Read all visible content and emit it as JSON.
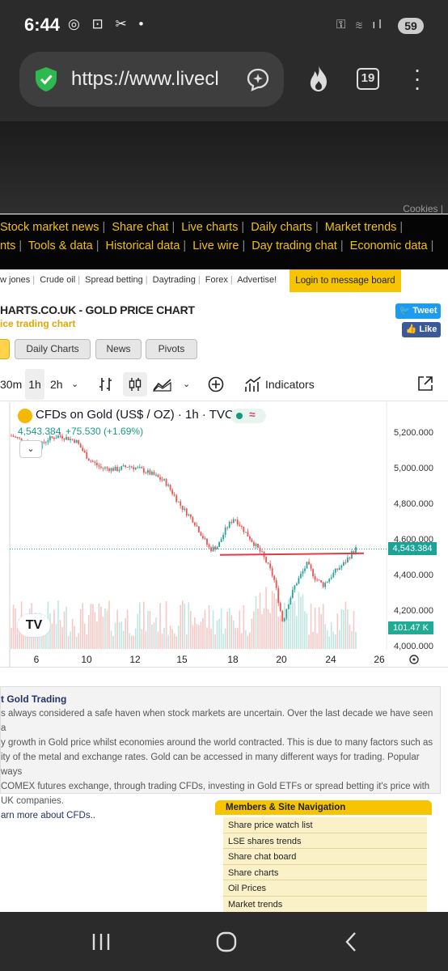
{
  "status": {
    "time": "6:44",
    "icons_left": "◎ ⊡ ✂ •",
    "icons_right": "⚿ ≋ ıl",
    "battery": "59"
  },
  "browser": {
    "url": "https://www.livecl",
    "tab_count": "19"
  },
  "site": {
    "cookies": "Cookies |",
    "nav_row1": [
      "Stock market news",
      "Share chat",
      "Live charts",
      "Daily charts",
      "Market trends"
    ],
    "nav_row2": [
      "nts",
      "Tools & data",
      "Historical data",
      "Live wire",
      "Day trading chat",
      "Economic data"
    ],
    "sub_links": [
      "w jones",
      "Crude oil",
      "Spread betting",
      "Daytrading",
      "Forex",
      "Advertise!"
    ],
    "login": "Login to message board",
    "page_title": "HARTS.CO.UK - GOLD PRICE CHART",
    "page_subtitle": "ice trading chart",
    "tweet": "Tweet",
    "like": "Like",
    "chart_tabs": [
      "Daily Charts",
      "News",
      "Pivots"
    ]
  },
  "toolbar": {
    "interval_30m": "30m",
    "interval_1h": "1h",
    "interval_2h": "2h",
    "indicators": "Indicators"
  },
  "chart_header": {
    "symbol": "CFDs on Gold (US$ / OZ) · 1h · TVC",
    "price": "4,543.384",
    "change": "+75.530 (+1.69%)",
    "last_label": "4,543.384",
    "volume_label": "101.47 K",
    "logo": "TV"
  },
  "chart_data": {
    "type": "candlestick",
    "title": "CFDs on Gold (US$ / OZ) · 1h · TVC",
    "x_ticks": [
      "6",
      "10",
      "12",
      "15",
      "18",
      "20",
      "24",
      "26"
    ],
    "y_ticks": [
      "5,200.000",
      "5,000.000",
      "4,800.000",
      "4,600.000",
      "4,400.000",
      "4,200.000",
      "4,000.000"
    ],
    "ylim": [
      3980,
      5260
    ],
    "price_path": [
      [
        0,
        5180
      ],
      [
        4,
        5140
      ],
      [
        6,
        5100
      ],
      [
        9,
        5160
      ],
      [
        12,
        5180
      ],
      [
        16,
        5150
      ],
      [
        19,
        5050
      ],
      [
        22,
        5000
      ],
      [
        26,
        4990
      ],
      [
        29,
        5010
      ],
      [
        32,
        4990
      ],
      [
        35,
        4960
      ],
      [
        38,
        4920
      ],
      [
        40,
        4850
      ],
      [
        42,
        4780
      ],
      [
        45,
        4700
      ],
      [
        47,
        4620
      ],
      [
        49,
        4540
      ],
      [
        51,
        4560
      ],
      [
        53,
        4660
      ],
      [
        55,
        4720
      ],
      [
        57,
        4660
      ],
      [
        59,
        4600
      ],
      [
        62,
        4510
      ],
      [
        64,
        4420
      ],
      [
        65,
        4360
      ],
      [
        66,
        4240
      ],
      [
        67,
        4130
      ],
      [
        68,
        4220
      ],
      [
        70,
        4340
      ],
      [
        73,
        4460
      ],
      [
        75,
        4380
      ],
      [
        77,
        4340
      ],
      [
        80,
        4420
      ],
      [
        82,
        4460
      ],
      [
        84,
        4520
      ],
      [
        85,
        4545
      ]
    ],
    "horizontal_line": 4510,
    "last_price": 4543.384,
    "grid": false
  },
  "description": {
    "title": "t Gold Trading",
    "lines": [
      "s always considered a safe haven when stock markets are uncertain. Over the last decade we have seen a",
      "y growth in Gold price whilst economies around the world contracted. This is due to many factors such as",
      "ity of the metal and exchange rates. Gold can be accessed in many different ways for trading. Popular ways",
      "COMEX futures exchange, through trading CFDs, investing in Gold ETFs or spread betting it's price with",
      "UK companies.",
      "arn more about CFDs.."
    ]
  },
  "members": {
    "title": "Members & Site Navigation",
    "items": [
      "Share price watch list",
      "LSE shares trends",
      "Share chat board",
      "Share charts",
      "Oil Prices",
      "Market trends"
    ]
  }
}
